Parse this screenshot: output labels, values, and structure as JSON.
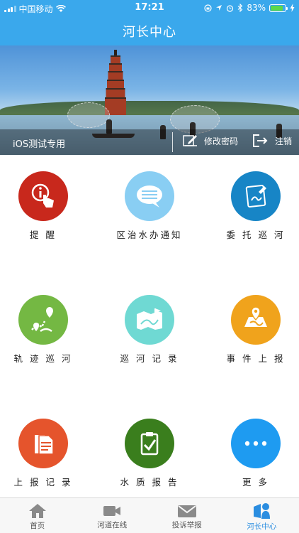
{
  "status_bar": {
    "carrier": "中国移动",
    "time": "17:21",
    "battery_percent": "83%",
    "battery_level": 0.83
  },
  "header": {
    "title": "河长中心"
  },
  "banner": {
    "user_label": "iOS测试专用",
    "change_password_label": "修改密码",
    "logout_label": "注销"
  },
  "grid": {
    "items": [
      {
        "label": "提 醒",
        "icon": "reminder-icon",
        "color": "#c8281c"
      },
      {
        "label": "区治水办通知",
        "icon": "message-icon",
        "color": "#89cef3"
      },
      {
        "label": "委 托 巡 河",
        "icon": "delegate-icon",
        "color": "#1785c6"
      },
      {
        "label": "轨 迹 巡 河",
        "icon": "track-icon",
        "color": "#74b843"
      },
      {
        "label": "巡 河 记 录",
        "icon": "patrol-record-icon",
        "color": "#6fd9d3"
      },
      {
        "label": "事 件 上 报",
        "icon": "event-report-icon",
        "color": "#f0a31c"
      },
      {
        "label": "上 报 记 录",
        "icon": "report-record-icon",
        "color": "#e5542c"
      },
      {
        "label": "水 质 报 告",
        "icon": "water-quality-icon",
        "color": "#3a7e1d"
      },
      {
        "label": "更 多",
        "icon": "more-icon",
        "color": "#1e9bf1"
      }
    ]
  },
  "tabbar": {
    "tabs": [
      {
        "label": "首页",
        "icon": "home-icon"
      },
      {
        "label": "河道在线",
        "icon": "video-icon"
      },
      {
        "label": "投诉举报",
        "icon": "mail-icon"
      },
      {
        "label": "河长中心",
        "icon": "person-badge-icon",
        "active": true
      }
    ]
  },
  "colors": {
    "primary": "#3aa8ec",
    "tab_active": "#2a8de0"
  }
}
